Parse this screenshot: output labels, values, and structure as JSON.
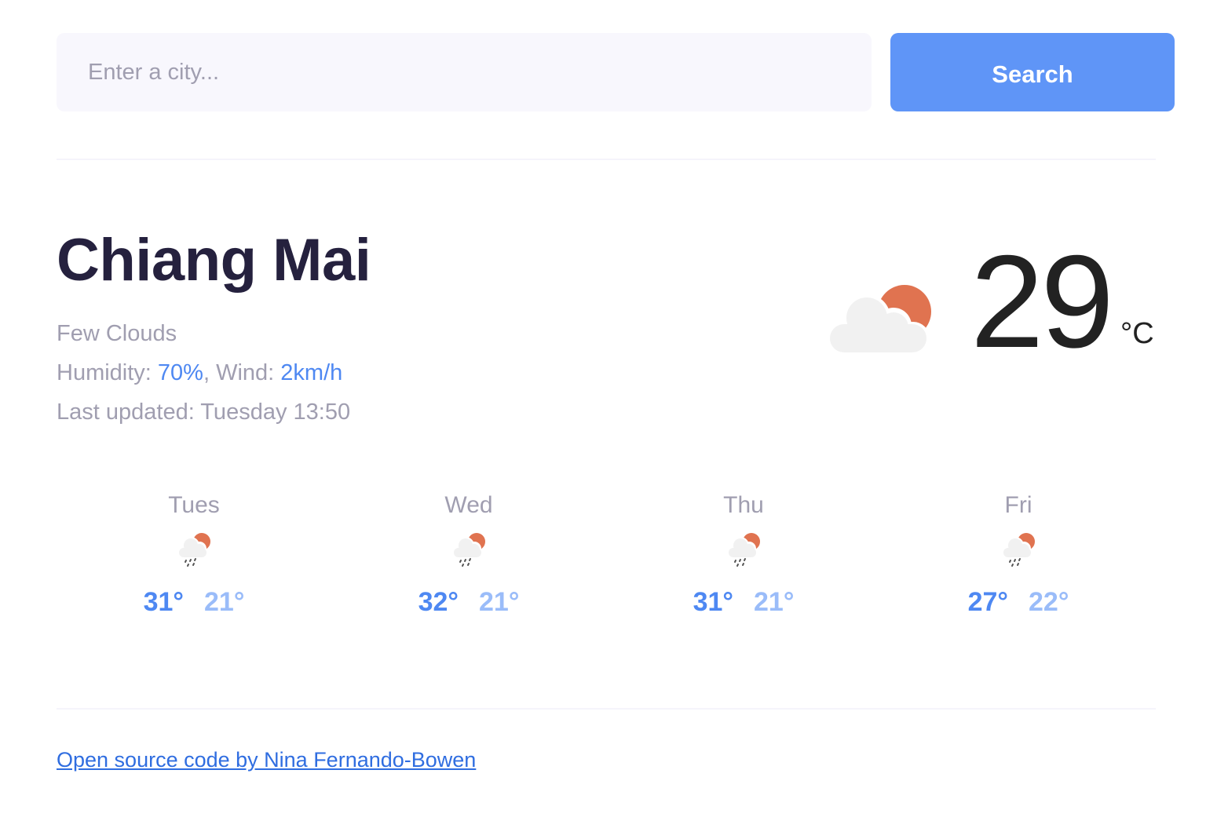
{
  "search": {
    "placeholder": "Enter a city...",
    "value": "",
    "button_label": "Search"
  },
  "current": {
    "city": "Chiang Mai",
    "description": "Few Clouds",
    "humidity_label": "Humidity: ",
    "humidity": "70%",
    "wind_label": ", Wind: ",
    "wind": "2km/h",
    "last_updated_label": "Last updated: ",
    "last_updated": "Tuesday 13:50",
    "icon": "few-clouds-day-icon",
    "temperature": "29",
    "unit": "°C"
  },
  "forecast": [
    {
      "day": "Tues",
      "icon": "rain-partly-cloudy-icon",
      "max": "31°",
      "min": "21°"
    },
    {
      "day": "Wed",
      "icon": "rain-partly-cloudy-icon",
      "max": "32°",
      "min": "21°"
    },
    {
      "day": "Thu",
      "icon": "rain-partly-cloudy-icon",
      "max": "31°",
      "min": "21°"
    },
    {
      "day": "Fri",
      "icon": "rain-partly-cloudy-icon",
      "max": "27°",
      "min": "22°"
    }
  ],
  "footer": {
    "link_text": "Open source code by Nina Fernando-Bowen"
  },
  "colors": {
    "accent": "#5f95f7",
    "highlight_text": "#4e88f2",
    "muted_text": "#a09eb0",
    "heading": "#25213e",
    "sun": "#e07350",
    "cloud": "#f1f1f1"
  }
}
